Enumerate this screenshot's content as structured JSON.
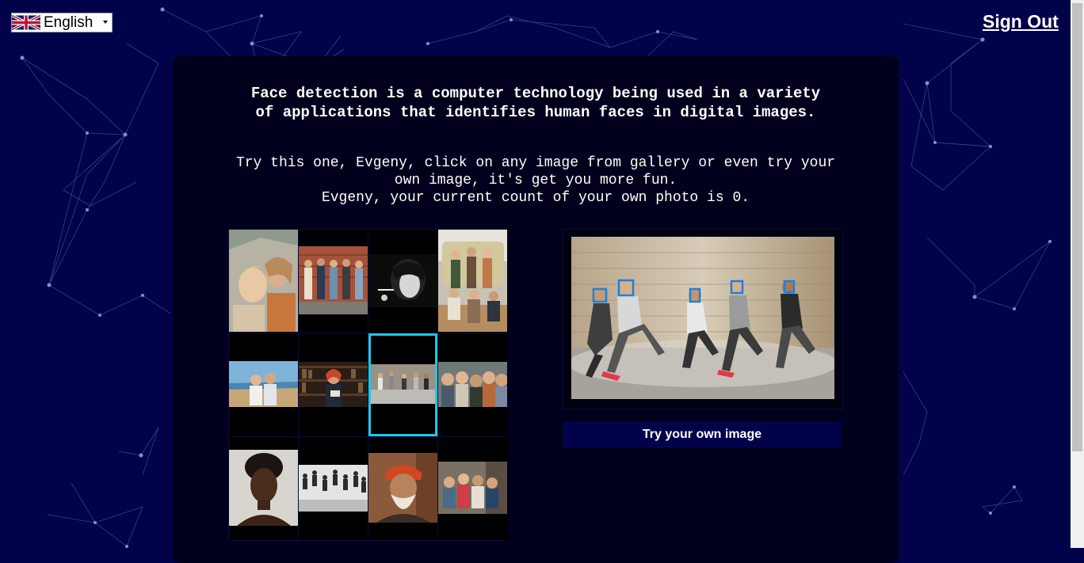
{
  "language": {
    "selected": "English",
    "flag_icon": "uk-flag-icon"
  },
  "header": {
    "sign_out": "Sign Out"
  },
  "panel": {
    "heading": "Face detection is a computer technology being used in a variety of applications that identifies human faces in digital images.",
    "intro_line1": "Try this one, Evgeny, click on any image from gallery or even try your own image, it's get you more fun.",
    "intro_line2": "Evgeny, your current count of your own photo is 0."
  },
  "gallery": {
    "selected_index": 6,
    "items": [
      {
        "name": "gallery-image-two-women"
      },
      {
        "name": "gallery-image-group-brick-wall"
      },
      {
        "name": "gallery-image-woman-bw"
      },
      {
        "name": "gallery-image-group-van"
      },
      {
        "name": "gallery-image-couple-beach"
      },
      {
        "name": "gallery-image-woman-library"
      },
      {
        "name": "gallery-image-dancers"
      },
      {
        "name": "gallery-image-friends-selfie"
      },
      {
        "name": "gallery-image-woman-portrait"
      },
      {
        "name": "gallery-image-jumping-group-bw"
      },
      {
        "name": "gallery-image-old-man-turban"
      },
      {
        "name": "gallery-image-friends-street"
      }
    ]
  },
  "preview": {
    "image": "detected-faces-dancers",
    "detected_faces": 5
  },
  "actions": {
    "try_own_image": "Try your own image"
  },
  "colors": {
    "background": "#02024a",
    "panel": "#00001c",
    "accent": "#1fc7e4",
    "face_box": "#1e7fe0"
  }
}
